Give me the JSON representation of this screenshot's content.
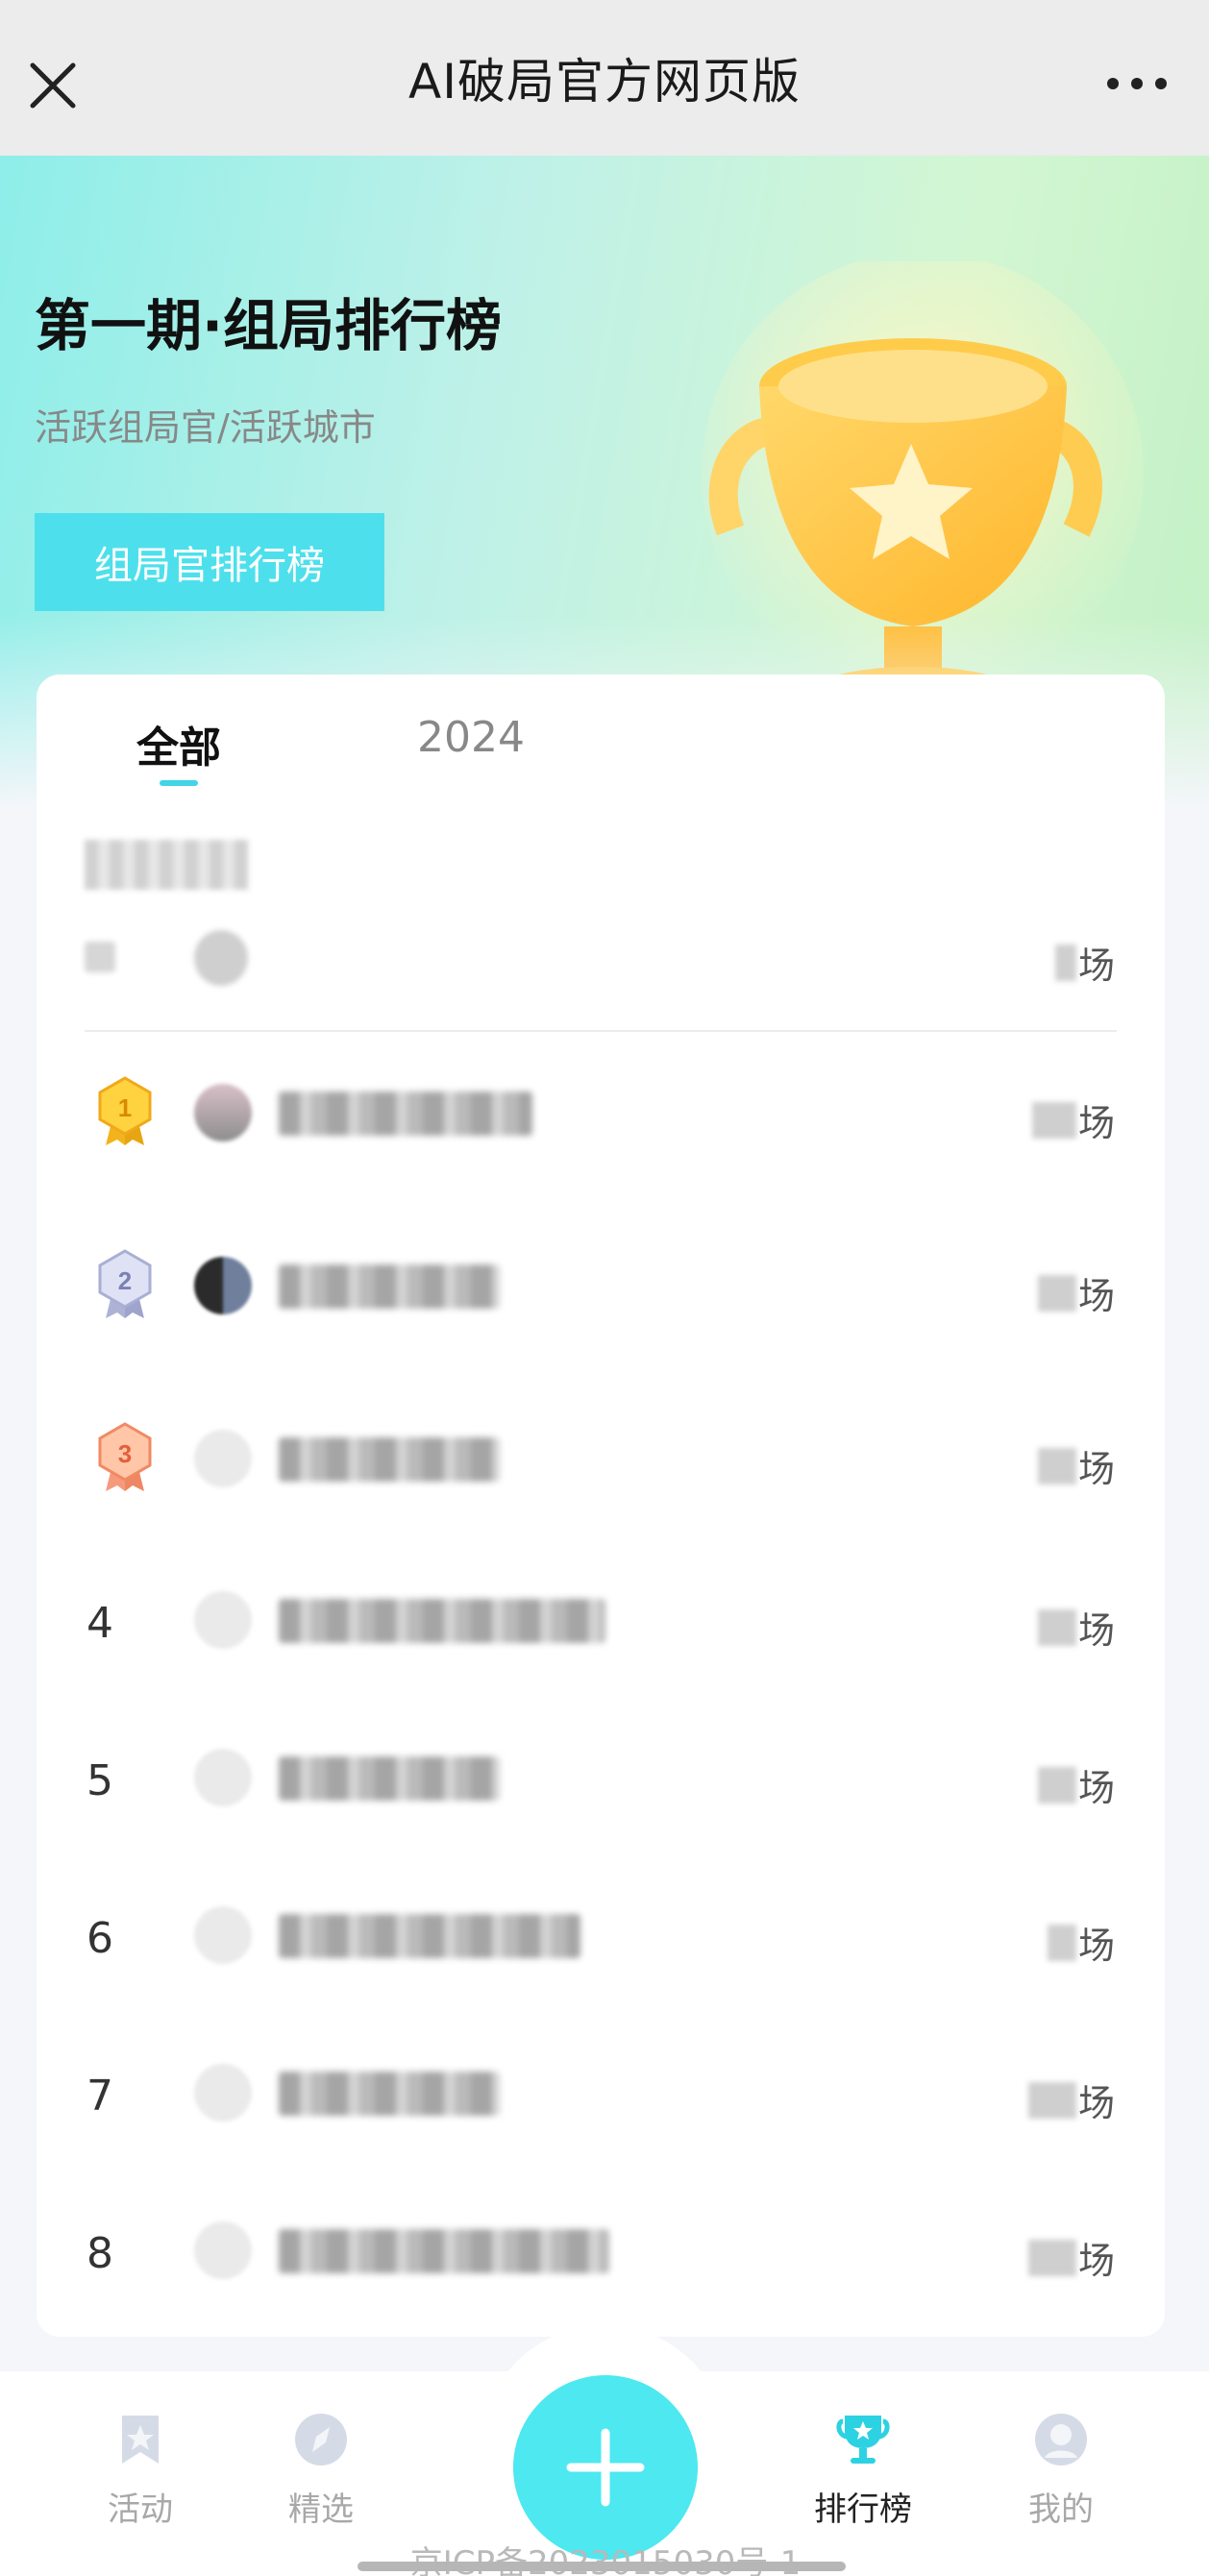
{
  "topbar": {
    "title": "AI破局官方网页版",
    "close_icon": "close-icon",
    "more_icon": "more-icon"
  },
  "hero": {
    "title": "第一期·组局排行榜",
    "subtitle": "活跃组局官/活跃城市",
    "button_label": "组局官排行榜",
    "accent": "#4de0ec"
  },
  "tabs": [
    {
      "label": "全部",
      "active": true
    },
    {
      "label": "2024",
      "active": false
    }
  ],
  "my_entry": {
    "unit": "场"
  },
  "rows": [
    {
      "rank": "1",
      "medal": "gold",
      "unit": "场"
    },
    {
      "rank": "2",
      "medal": "silver",
      "unit": "场"
    },
    {
      "rank": "3",
      "medal": "bronze",
      "unit": "场"
    },
    {
      "rank": "4",
      "unit": "场"
    },
    {
      "rank": "5",
      "unit": "场"
    },
    {
      "rank": "6",
      "unit": "场"
    },
    {
      "rank": "7",
      "unit": "场"
    },
    {
      "rank": "8",
      "unit": "场"
    }
  ],
  "nav": {
    "items": [
      {
        "label": "活动",
        "icon": "bookmark-star-icon"
      },
      {
        "label": "精选",
        "icon": "compass-icon"
      },
      {
        "label": "排行榜",
        "icon": "trophy-icon",
        "active": true
      },
      {
        "label": "我的",
        "icon": "profile-icon"
      }
    ],
    "fab_icon": "plus-icon"
  },
  "footer": {
    "icp": "京ICP备2023015030号-1"
  }
}
